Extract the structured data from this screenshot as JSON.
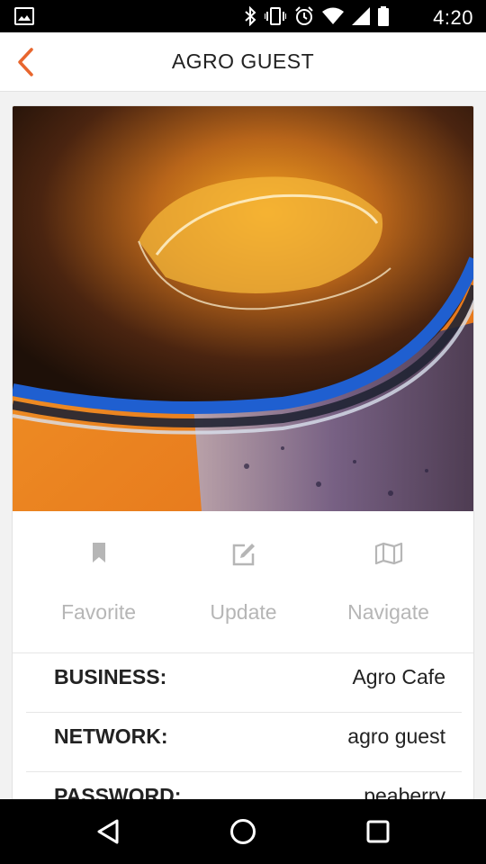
{
  "status_bar": {
    "time": "4:20",
    "icons": [
      "image-notification-icon",
      "bluetooth-icon",
      "vibrate-icon",
      "alarm-icon",
      "wifi-icon",
      "cell-signal-icon",
      "battery-icon"
    ]
  },
  "app_bar": {
    "title": "AGRO GUEST",
    "back_icon": "chevron-left-icon",
    "accent_color": "#e8662e"
  },
  "card": {
    "photo_alt": "coffee-photo",
    "actions": [
      {
        "label": "Favorite",
        "icon": "bookmark-icon"
      },
      {
        "label": "Update",
        "icon": "edit-icon"
      },
      {
        "label": "Navigate",
        "icon": "map-icon"
      }
    ],
    "details": [
      {
        "key": "BUSINESS:",
        "value": "Agro Cafe"
      },
      {
        "key": "NETWORK:",
        "value": "agro guest"
      },
      {
        "key": "PASSWORD:",
        "value": "peaberry"
      }
    ]
  },
  "nav_bar": {
    "buttons": [
      "back-triangle-icon",
      "home-circle-icon",
      "recents-square-icon"
    ]
  }
}
